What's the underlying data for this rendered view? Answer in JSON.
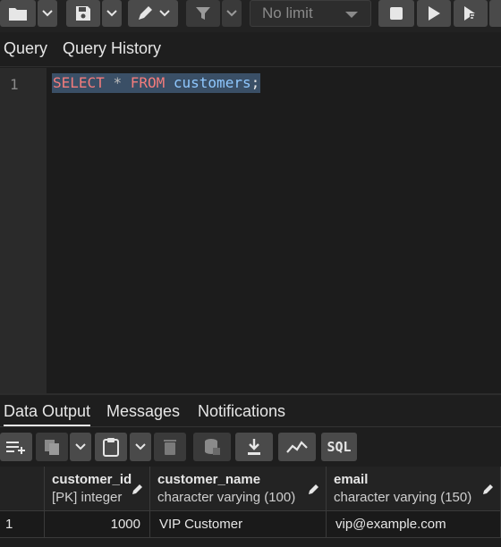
{
  "toolbar": {
    "buttons": [
      "folder-icon",
      "save-icon",
      "edit-icon",
      "filter-icon",
      "stop-icon",
      "execute-icon",
      "execute-explain-icon"
    ],
    "limit_select": {
      "value": "No limit"
    }
  },
  "query_tabs": [
    {
      "label": "Query",
      "active": true
    },
    {
      "label": "Query History",
      "active": false
    }
  ],
  "editor": {
    "line_number": "1",
    "tokens": {
      "select_kw": "SELECT",
      "star": "*",
      "from_kw": "FROM",
      "table": "customers",
      "semicolon": ";"
    }
  },
  "bottom_tabs": [
    {
      "label": "Data Output",
      "active": true
    },
    {
      "label": "Messages",
      "active": false
    },
    {
      "label": "Notifications",
      "active": false
    }
  ],
  "result_toolbar": {
    "buttons": [
      "add-row-icon",
      "copy-icon",
      "paste-icon",
      "delete-icon",
      "save-data-icon",
      "download-icon",
      "graph-icon"
    ],
    "sql_label": "SQL"
  },
  "grid": {
    "columns": [
      {
        "name": "customer_id",
        "type": "[PK] integer"
      },
      {
        "name": "customer_name",
        "type": "character varying (100)"
      },
      {
        "name": "email",
        "type": "character varying (150)"
      }
    ],
    "rows": [
      {
        "row_num": "1",
        "customer_id": "1000",
        "customer_name": "VIP Customer",
        "email": "vip@example.com"
      }
    ]
  },
  "colors": {
    "background": "#1e1e1e",
    "keyword": "#f47c7c",
    "identifier": "#8fc8ff",
    "selection": "#3a4f66",
    "button": "#4a4a4a"
  }
}
